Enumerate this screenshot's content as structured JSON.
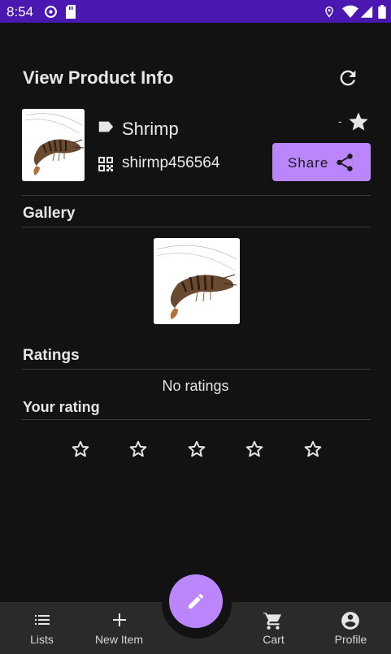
{
  "status_bar": {
    "time": "8:54",
    "background": "#4a17b0"
  },
  "header": {
    "title": "View Product Info",
    "refresh_icon": "refresh-icon"
  },
  "product": {
    "name": "Shrimp",
    "code": "shirmp456564",
    "rating_text": "-",
    "share_label": "Share",
    "tag_icon": "label-icon",
    "code_icon": "qr-code-icon",
    "favorite_icon": "star-filled-icon"
  },
  "gallery": {
    "title": "Gallery"
  },
  "ratings": {
    "title": "Ratings",
    "empty_text": "No ratings"
  },
  "your_rating": {
    "title": "Your rating",
    "stars": 5,
    "selected": 0
  },
  "fab": {
    "icon": "edit-pencil-icon"
  },
  "bottom_nav": {
    "items": [
      {
        "label": "Lists",
        "icon": "list-icon"
      },
      {
        "label": "New Item",
        "icon": "plus-icon"
      },
      {
        "label": "Cart",
        "icon": "cart-icon"
      },
      {
        "label": "Profile",
        "icon": "account-circle-icon"
      }
    ]
  },
  "colors": {
    "accent": "#bb86fc",
    "background": "#121212",
    "nav_background": "#2a2a2a"
  }
}
